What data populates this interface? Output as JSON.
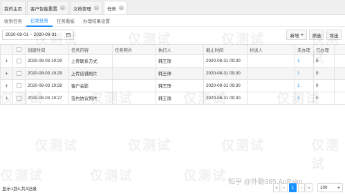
{
  "tabs": [
    {
      "label": "我的主页",
      "closable": false
    },
    {
      "label": "客户智能重置",
      "closable": true
    },
    {
      "label": "文档管理",
      "closable": true
    },
    {
      "label": "任务",
      "closable": true,
      "active": true
    }
  ],
  "subtabs": [
    "收到任务",
    "已发任务",
    "任务看板",
    "办理结果设置"
  ],
  "toolbar": {
    "date_range": "2020-08-01 ~ 2020-08-31",
    "add_label": "新增",
    "filter_label": "筛选",
    "export_label": "导出"
  },
  "table": {
    "columns": [
      "创建时间",
      "任务内容",
      "任务照片",
      "执行人",
      "截止时间",
      "抄送人",
      "未办理",
      "已办理"
    ],
    "rows": [
      {
        "created": "2020-08-03 19:29",
        "content": "上传联系方式",
        "photo": "",
        "executor": "韩王琤",
        "deadline": "2020-08-31 09:30",
        "cc": "",
        "pending": "1",
        "done": "0"
      },
      {
        "created": "2020-08-03 19:29",
        "content": "上传店铺照片",
        "photo": "",
        "executor": "韩王琤",
        "deadline": "2020-08-31 09:30",
        "cc": "",
        "pending": "1",
        "done": "0"
      },
      {
        "created": "2020-08-03 19:28",
        "content": "客户会影",
        "photo": "",
        "executor": "韩王琤",
        "deadline": "2020-08-31 09:30",
        "cc": "",
        "pending": "1",
        "done": "0"
      },
      {
        "created": "2020-08-03 19:27",
        "content": "签约协议照片",
        "photo": "",
        "executor": "韩王琤",
        "deadline": "2020-08-31 09:30",
        "cc": "",
        "pending": "1",
        "done": "0"
      }
    ]
  },
  "footer": {
    "info": "显示1到4,共4记录",
    "current_page": "1",
    "page_size": "100"
  },
  "watermark_text": "仅测试",
  "brand_text": "知乎 @外勤365 AirPalm",
  "colors": {
    "accent": "#1890ff"
  }
}
